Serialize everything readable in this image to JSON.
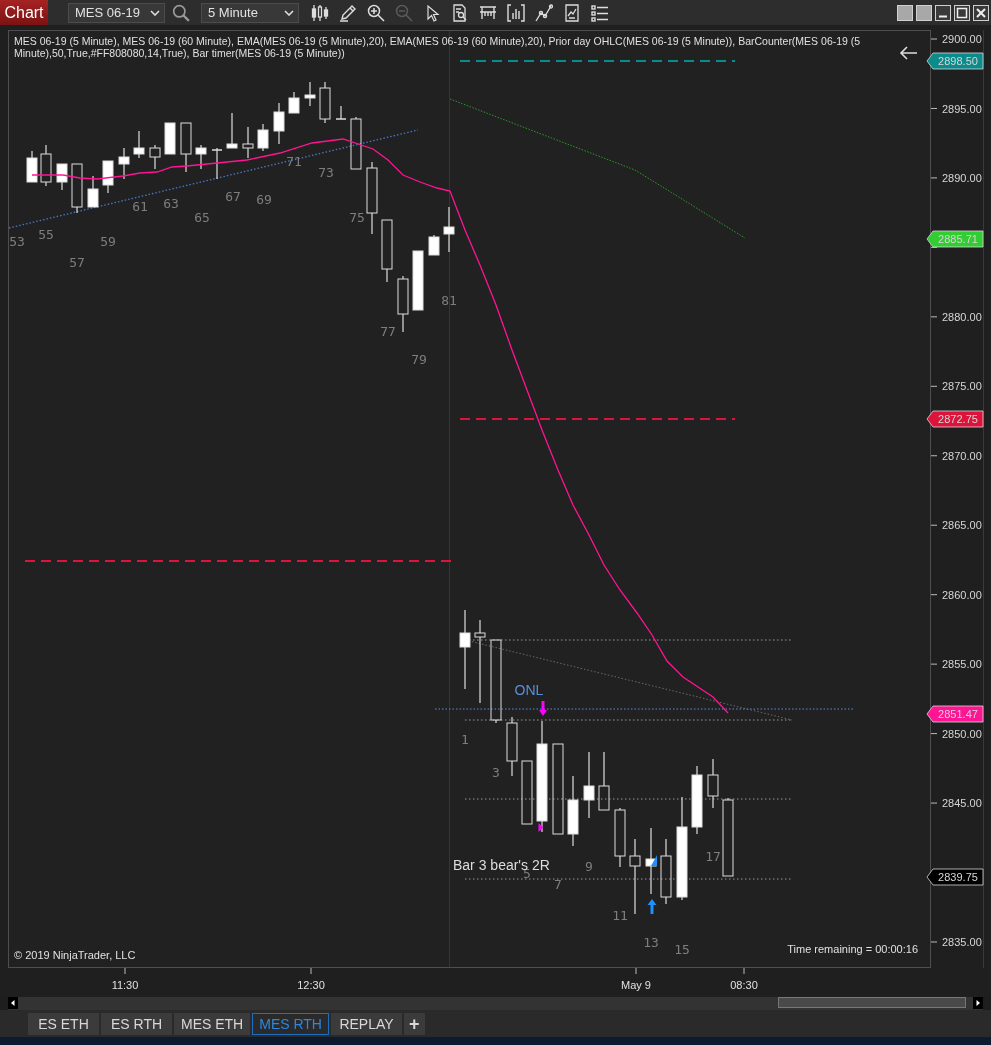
{
  "toolbar": {
    "chart_button": "Chart",
    "instrument": "MES 06-19",
    "interval": "5 Minute",
    "zoom_out_disabled": true
  },
  "chart": {
    "legend": "MES 06-19 (5 Minute), MES 06-19 (60 Minute), EMA(MES 06-19 (5 Minute),20), EMA(MES 06-19 (60 Minute),20), Prior day OHLC(MES 06-19 (5 Minute)), BarCounter(MES 06-19 (5 Minute),50,True,#FF808080,14,True), Bar timer(MES 06-19 (5 Minute))",
    "price_axis": [
      "2900.00",
      "2895.00",
      "2890.00",
      "2880.00",
      "2875.00",
      "2870.00",
      "2865.00",
      "2860.00",
      "2855.00",
      "2850.00",
      "2845.00",
      "2835.00"
    ],
    "price_markers": [
      {
        "label": "2898.50",
        "color": "#0b8b8b"
      },
      {
        "label": "2885.71",
        "color": "#32cd32"
      },
      {
        "label": "2872.75",
        "color": "#dc143c"
      },
      {
        "label": "2851.47",
        "color": "#ff1493"
      },
      {
        "label": "2839.75",
        "color": "#000000"
      }
    ],
    "time_axis": [
      "11:30",
      "12:30",
      "May 9",
      "08:30"
    ],
    "bar_counts": [
      "53",
      "55",
      "57",
      "59",
      "61",
      "63",
      "65",
      "67",
      "69",
      "71",
      "73",
      "75",
      "77",
      "79",
      "81",
      "1",
      "3",
      "5",
      "7",
      "9",
      "11",
      "13",
      "15",
      "17"
    ],
    "onl_label": "ONL",
    "note": "Bar 3 bear's 2R",
    "copyright": "© 2019 NinjaTrader, LLC",
    "time_remaining": "Time remaining = 00:00:16"
  },
  "tabs": [
    {
      "label": "ES ETH",
      "selected": false
    },
    {
      "label": "ES RTH",
      "selected": false
    },
    {
      "label": "MES ETH",
      "selected": false
    },
    {
      "label": "MES RTH",
      "selected": true
    },
    {
      "label": "REPLAY",
      "selected": false
    }
  ],
  "add_tab": "+"
}
